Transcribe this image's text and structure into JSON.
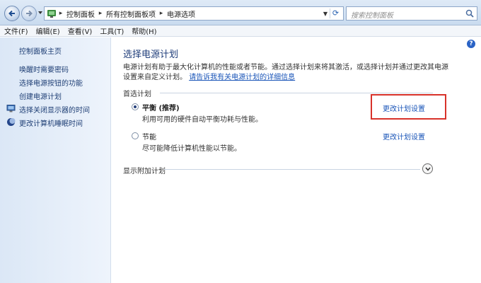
{
  "address_bar": {
    "breadcrumbs": [
      "控制面板",
      "所有控制面板项",
      "电源选项"
    ],
    "search_placeholder": "搜索控制面板"
  },
  "menu": [
    "文件(F)",
    "编辑(E)",
    "查看(V)",
    "工具(T)",
    "帮助(H)"
  ],
  "sidebar": {
    "home": "控制面板主页",
    "links": [
      "唤醒时需要密码",
      "选择电源按钮的功能",
      "创建电源计划",
      "选择关闭显示器的时间",
      "更改计算机睡眠时间"
    ]
  },
  "content": {
    "title": "选择电源计划",
    "description": "电源计划有助于最大化计算机的性能或者节能。通过选择计划来将其激活，或选择计划并通过更改其电源设置来自定义计划。",
    "description_link": "请告诉我有关电源计划的详细信息",
    "preferred_label": "首选计划",
    "plans": [
      {
        "name": "平衡 (推荐)",
        "desc": "利用可用的硬件自动平衡功耗与性能。",
        "selected": true,
        "link": "更改计划设置"
      },
      {
        "name": "节能",
        "desc": "尽可能降低计算机性能以节能。",
        "selected": false,
        "link": "更改计划设置"
      }
    ],
    "more_plans_label": "显示附加计划"
  },
  "colors": {
    "link": "#1a55b8",
    "title": "#1f3d7a",
    "highlight_box": "#d8322a",
    "sidebar_bg": "#dbe7f6"
  },
  "icons": [
    "back-arrow-icon",
    "forward-arrow-icon",
    "control-panel-icon",
    "refresh-icon",
    "search-icon",
    "help-icon",
    "monitor-icon",
    "moon-icon",
    "chevron-down-icon"
  ]
}
